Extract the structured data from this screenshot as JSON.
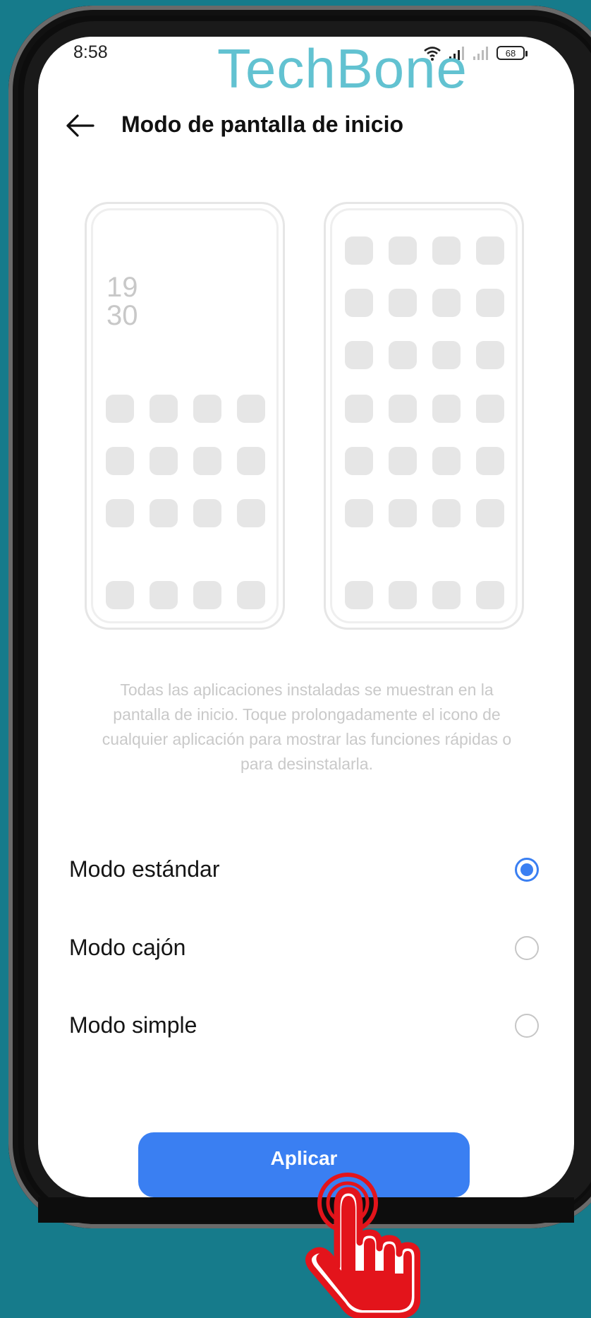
{
  "status_bar": {
    "time": "8:58",
    "battery": "68"
  },
  "watermark": "TechBone",
  "header": {
    "title": "Modo de pantalla de inicio"
  },
  "preview": {
    "clock_hour": "19",
    "clock_minute": "30"
  },
  "description": "Todas las aplicaciones instaladas se muestran en la pantalla de inicio. Toque prolongadamente el icono de cualquier aplicación para mostrar las funciones rápidas o para desinstalarla.",
  "options": [
    {
      "label": "Modo estándar",
      "selected": true
    },
    {
      "label": "Modo cajón",
      "selected": false
    },
    {
      "label": "Modo simple",
      "selected": false
    }
  ],
  "apply_button": {
    "label": "Aplicar"
  },
  "colors": {
    "accent": "#3a7ff2",
    "background": "#167b8b",
    "watermark": "#62c2d1",
    "hand": "#e3141b"
  }
}
